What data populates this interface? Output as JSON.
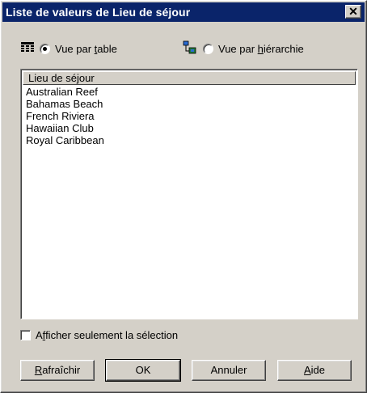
{
  "window": {
    "title": "Liste de valeurs de Lieu de séjour",
    "close_label": "✕"
  },
  "views": {
    "table": {
      "prefix": "Vue par ",
      "underlined": "t",
      "suffix": "able",
      "selected": true,
      "icon": "table-grid-icon"
    },
    "hierarchy": {
      "prefix": "Vue par ",
      "underlined": "h",
      "suffix": "iérarchie",
      "selected": false,
      "icon": "hierarchy-icon"
    }
  },
  "list": {
    "column_header": "Lieu de séjour",
    "items": [
      "Australian Reef",
      "Bahamas Beach",
      "French Riviera",
      "Hawaiian Club",
      "Royal Caribbean"
    ]
  },
  "show_selection": {
    "prefix": "A",
    "underlined": "f",
    "suffix": "ficher seulement la sélection",
    "checked": false
  },
  "buttons": {
    "refresh": {
      "underlined": "R",
      "rest": "afraîchir"
    },
    "ok": "OK",
    "cancel": "Annuler",
    "help": {
      "underlined": "A",
      "rest": "ide"
    }
  },
  "colors": {
    "titlebar": "#0a246a",
    "face": "#d4d0c8"
  }
}
